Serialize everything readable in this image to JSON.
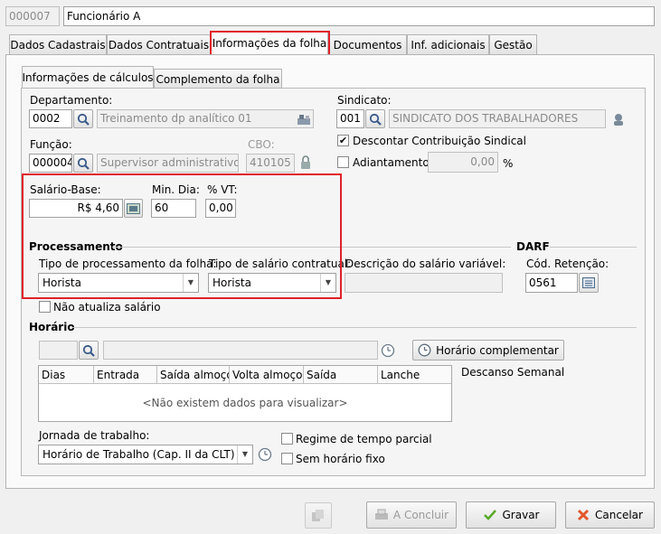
{
  "header": {
    "code": "000007",
    "name": "Funcionário A"
  },
  "tabs": [
    {
      "label": "Dados Cadastrais"
    },
    {
      "label": "Dados Contratuais"
    },
    {
      "label": "Informações da folha"
    },
    {
      "label": "Documentos"
    },
    {
      "label": "Inf. adicionais"
    },
    {
      "label": "Gestão"
    }
  ],
  "subtabs": [
    {
      "label": "Informações de cálculos"
    },
    {
      "label": "Complemento da folha"
    }
  ],
  "departamento": {
    "label": "Departamento:",
    "code": "0002",
    "name": "Treinamento dp analítico  01"
  },
  "funcao": {
    "label": "Função:",
    "code": "000004",
    "name": "Supervisor administrativo",
    "cbo_label": "CBO:",
    "cbo": "410105"
  },
  "sindicato": {
    "label": "Sindicato:",
    "code": "001",
    "name": "SINDICATO DOS TRABALHADORES"
  },
  "descontar": {
    "label": "Descontar Contribuição Sindical",
    "checked": true
  },
  "adiantamento": {
    "label": "Adiantamento",
    "value": "0,00",
    "unit": "%",
    "checked": false
  },
  "salario": {
    "label": "Salário-Base:",
    "value": "R$ 4,60"
  },
  "min_dia": {
    "label": "Min. Dia:",
    "value": "60"
  },
  "vt": {
    "label": "% VT:",
    "value": "0,00"
  },
  "processamento": {
    "title": "Processamento",
    "tipo_proc_label": "Tipo de processamento da folha:",
    "tipo_proc_value": "Horista",
    "tipo_sal_label": "Tipo de salário contratual:",
    "tipo_sal_value": "Horista",
    "desc_label": "Descrição do salário variável:",
    "nao_atualiza": "Não atualiza salário"
  },
  "darf": {
    "title": "DARF",
    "label": "Cód. Retenção:",
    "value": "0561"
  },
  "horario": {
    "title": "Horário",
    "complementar": "Horário complementar",
    "columns": [
      "Dias",
      "Entrada",
      "Saída almoço",
      "Volta almoço",
      "Saída",
      "Lanche"
    ],
    "empty": "<Não existem dados para visualizar>",
    "descanso": "Descanso Semanal",
    "jornada_label": "Jornada de trabalho:",
    "jornada_value": "Horário de Trabalho (Cap. II da CLT)",
    "regime": "Regime de tempo parcial",
    "sem_fixo": "Sem horário fixo"
  },
  "buttons": {
    "concluir": "A Concluir",
    "gravar": "Gravar",
    "cancelar": "Cancelar"
  }
}
